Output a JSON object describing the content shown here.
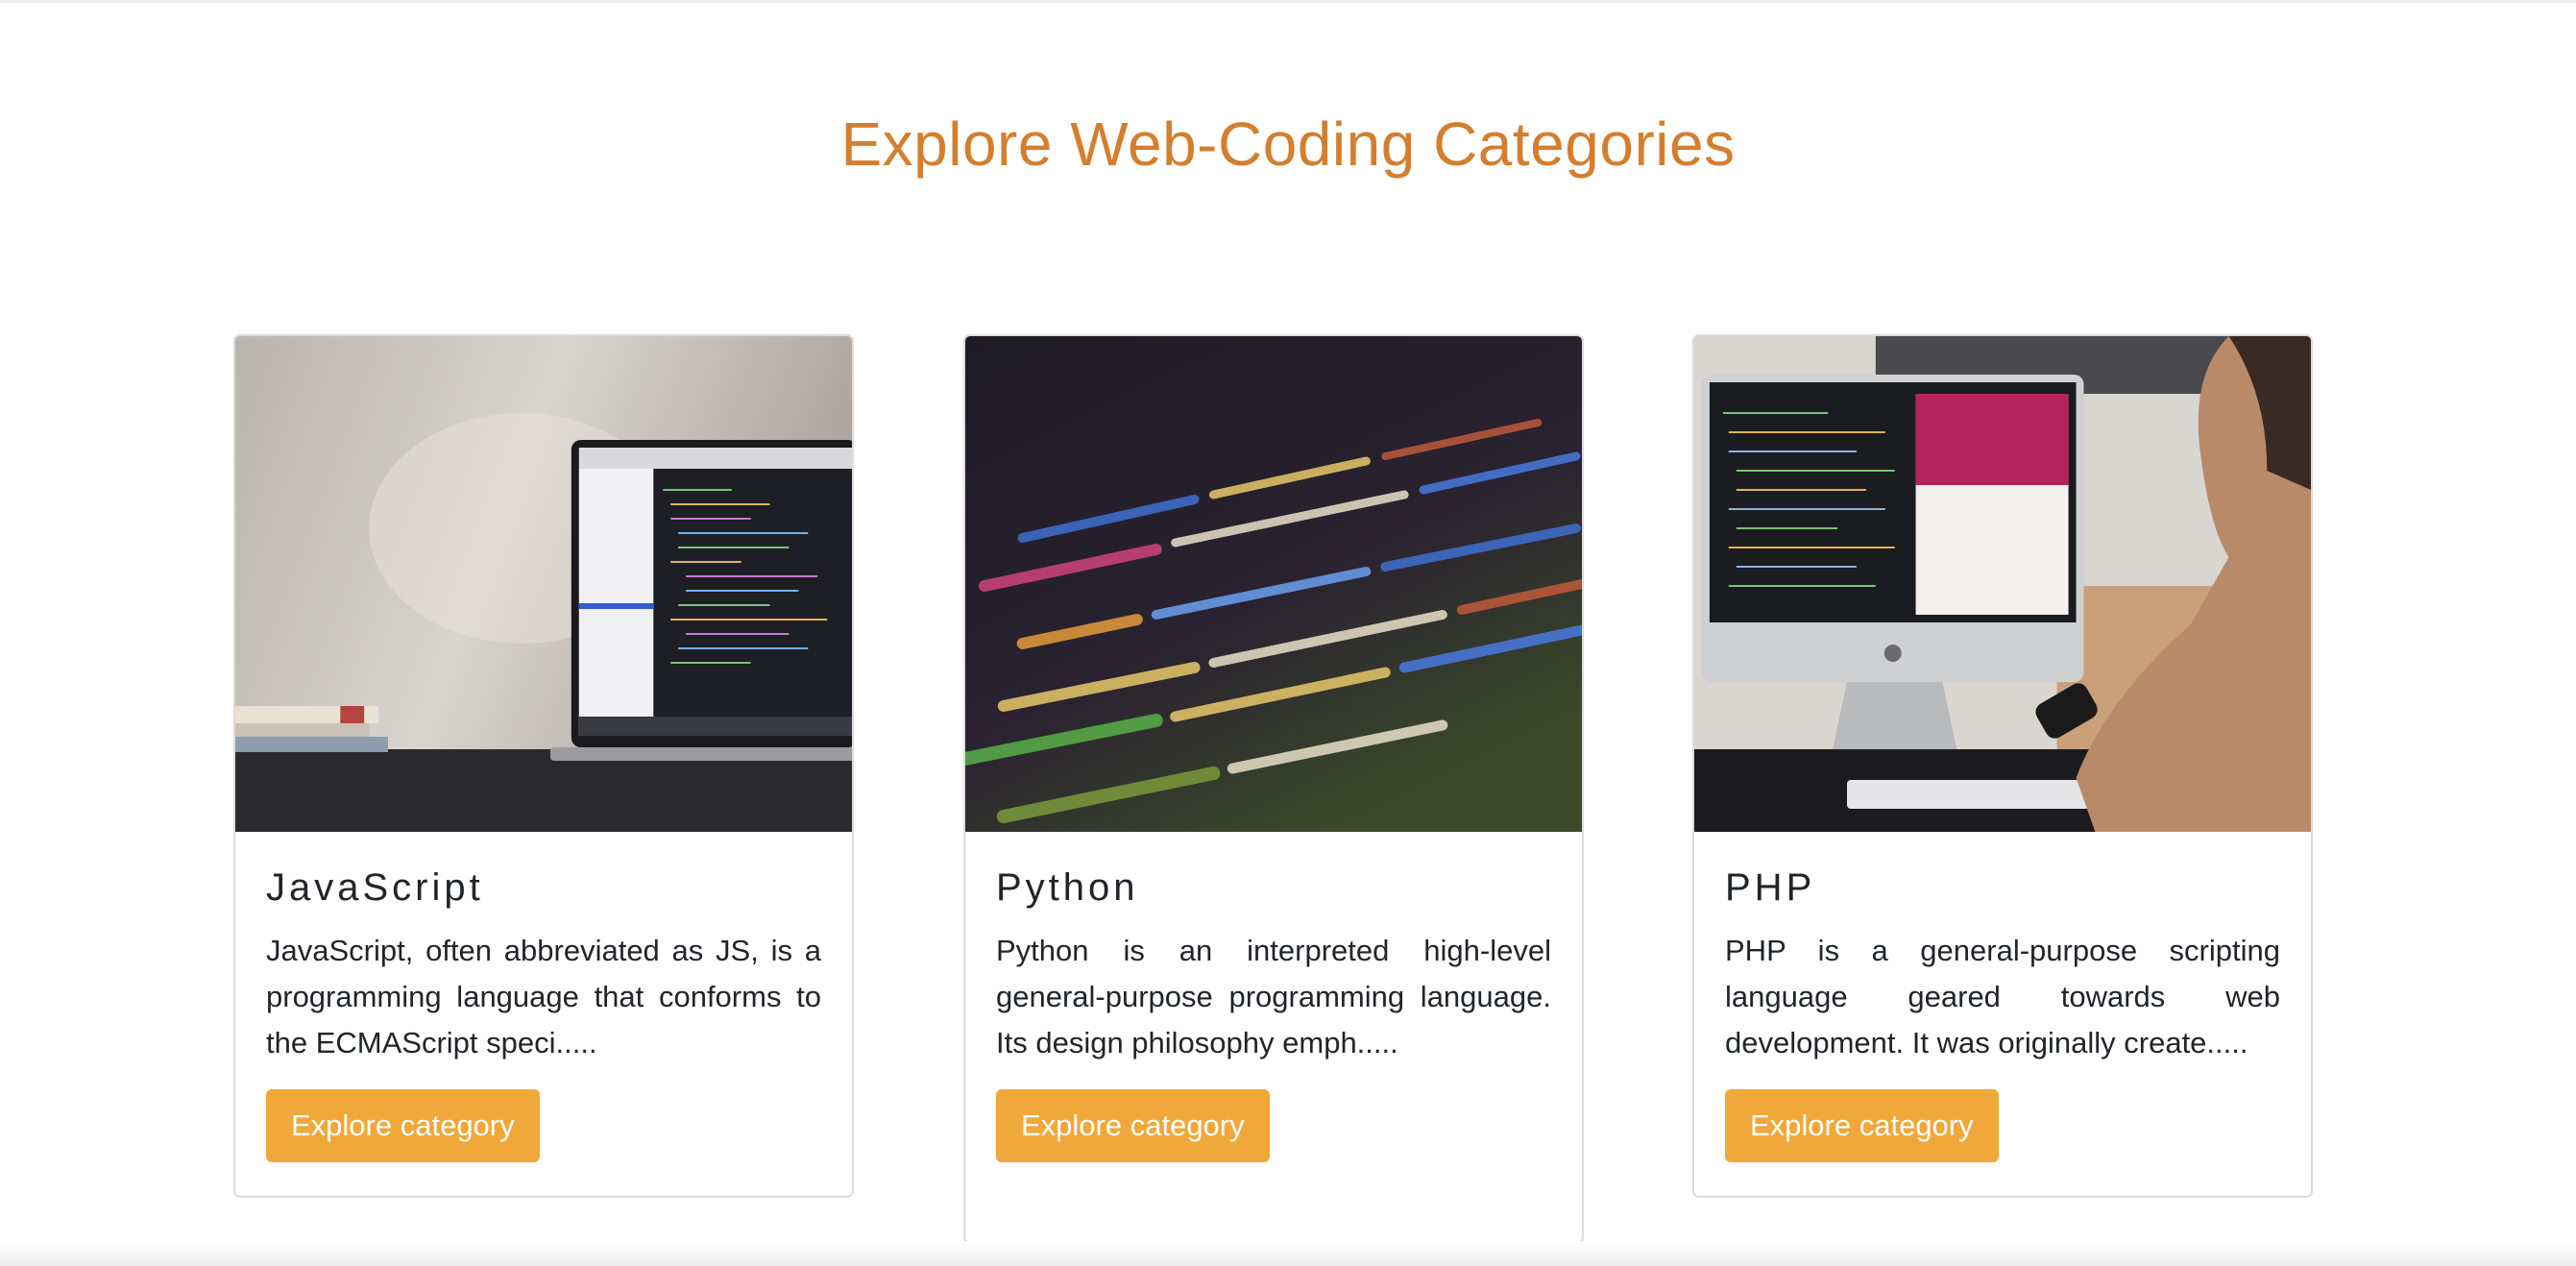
{
  "page": {
    "title": "Explore Web-Coding Categories",
    "title_color": "#d47e2f",
    "button_color": "#f0a83a"
  },
  "cards": [
    {
      "title": "JavaScript",
      "image_icon": "laptop-code-photo",
      "description": "JavaScript, often abbreviated as JS, is a programming language that conforms to the ECMAScript speci.....",
      "button_label": "Explore category"
    },
    {
      "title": "Python",
      "image_icon": "code-screen-photo",
      "description": "Python is an interpreted high-level general-purpose programming language. Its design philosophy emph.....",
      "button_label": "Explore category"
    },
    {
      "title": "PHP",
      "image_icon": "desktop-developer-photo",
      "description": "PHP is a general-purpose scripting language geared towards web development. It was originally create.....",
      "button_label": "Explore category"
    }
  ]
}
